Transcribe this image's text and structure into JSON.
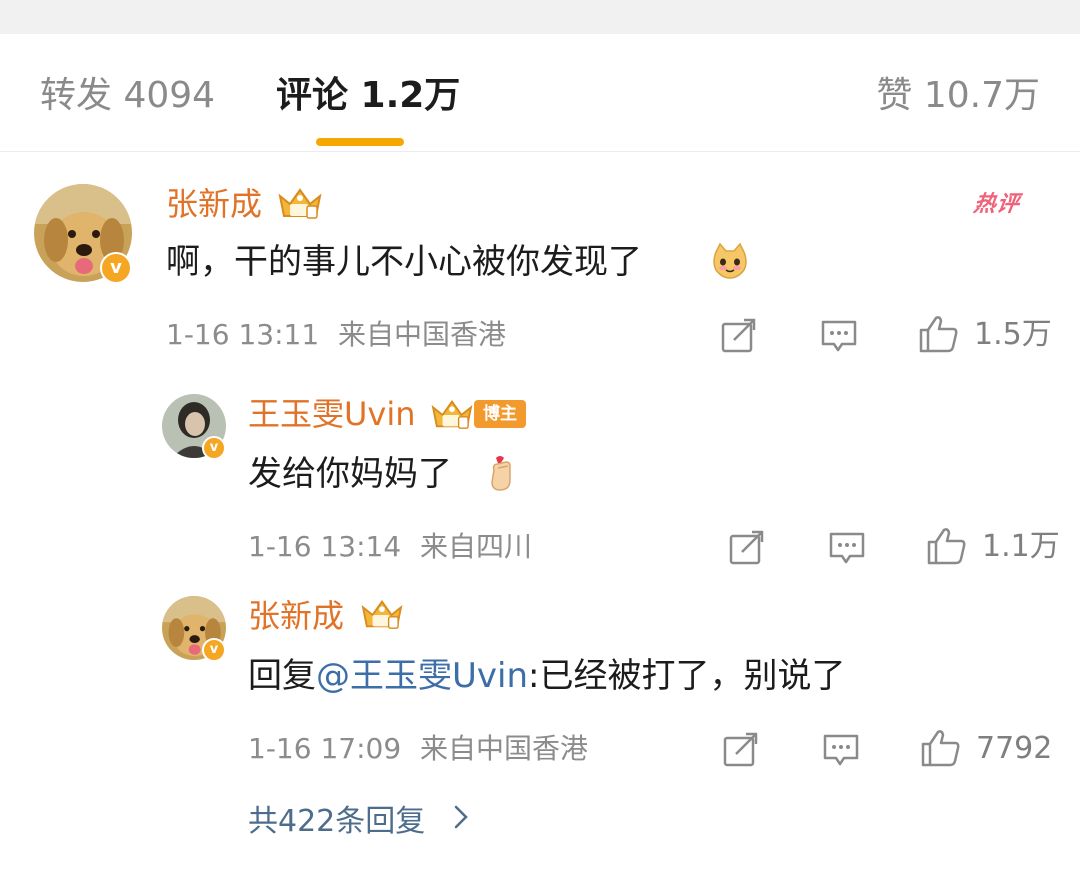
{
  "tabs": {
    "reposts": "转发 4094",
    "comments": "评论 1.2万",
    "likes": "赞 10.7万"
  },
  "hot_tag": "热评",
  "comments": [
    {
      "user": "张新成",
      "verified_badge": "v",
      "text": "啊，干的事儿不小心被你发现了",
      "emoji": "cat-face-emoji",
      "time": "1-16 13:11",
      "location": "来自中国香港",
      "likes": "1.5万"
    },
    {
      "user": "王玉雯Uvin",
      "verified_badge": "v",
      "role_tag": "博主",
      "text": "发给你妈妈了",
      "emoji": "finger-heart-emoji",
      "time": "1-16 13:14",
      "location": "来自四川",
      "likes": "1.1万"
    },
    {
      "user": "张新成",
      "verified_badge": "v",
      "reply_prefix": "回复",
      "mention": "@王玉雯Uvin",
      "text": ":已经被打了，别说了",
      "time": "1-16 17:09",
      "location": "来自中国香港",
      "likes": "7792"
    }
  ],
  "more_replies": "共422条回复",
  "colors": {
    "accent": "#f7a800",
    "username": "#e17328",
    "mention": "#3d6ea8",
    "hot_tag": "#f0627a"
  }
}
